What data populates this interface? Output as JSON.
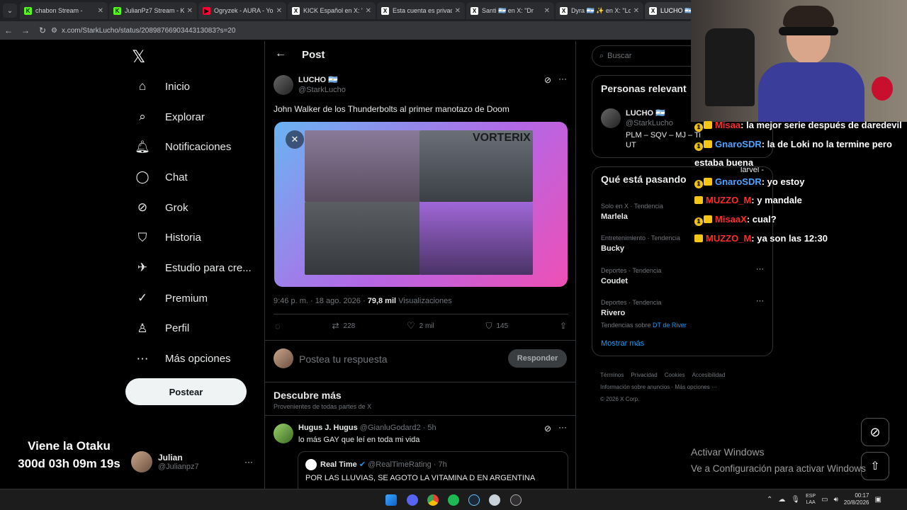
{
  "tabs": [
    {
      "label": "chabon Stream - ",
      "color": "#53fc18",
      "glyph": "K"
    },
    {
      "label": "JulianPz7 Stream - Ki",
      "color": "#53fc18",
      "glyph": "K"
    },
    {
      "label": "Ogryzek - AURA - You",
      "color": "#ff0033",
      "glyph": "▶"
    },
    {
      "label": "KICK Español en X: \"",
      "color": "#ffffff",
      "glyph": "X"
    },
    {
      "label": "Esta cuenta es privad",
      "color": "#ffffff",
      "glyph": "X"
    },
    {
      "label": "Santi 🇦🇷 en X: \"Dr",
      "color": "#ffffff",
      "glyph": "X"
    },
    {
      "label": "Dyra 🇦🇷 ✨ en X: \"Lo",
      "color": "#ffffff",
      "glyph": "X"
    },
    {
      "label": "LUCHO 🇦🇷 en X: \"",
      "color": "#ffffff",
      "glyph": "X"
    }
  ],
  "address": "x.com/StarkLucho/status/2089876690344313083?s=20",
  "nav": {
    "logo": "𝕏",
    "items": [
      {
        "icon": "home-icon",
        "glyph": "⌂",
        "label": "Inicio"
      },
      {
        "icon": "search-icon",
        "glyph": "⌕",
        "label": "Explorar"
      },
      {
        "icon": "bell-icon",
        "glyph": "🔔︎",
        "label": "Notificaciones"
      },
      {
        "icon": "chat-icon",
        "glyph": "◯",
        "label": "Chat"
      },
      {
        "icon": "grok-icon",
        "glyph": "⊘",
        "label": "Grok"
      },
      {
        "icon": "bookmark-icon",
        "glyph": "⛉",
        "label": "Historia"
      },
      {
        "icon": "rocket-icon",
        "glyph": "✈",
        "label": "Estudio para cre..."
      },
      {
        "icon": "verified-icon",
        "glyph": "✓",
        "label": "Premium"
      },
      {
        "icon": "person-icon",
        "glyph": "♙",
        "label": "Perfil"
      },
      {
        "icon": "more-icon",
        "glyph": "⋯",
        "label": "Más opciones"
      }
    ],
    "post_button": "Postear",
    "user": {
      "name": "Julian",
      "handle": "@Julianpz7",
      "more": "···"
    }
  },
  "overlay_timer": {
    "title": "Viene la Otaku",
    "countdown": "300d 03h 09m 19s"
  },
  "post": {
    "header": "Post",
    "author": "LUCHO 🇦🇷",
    "handle": "@StarkLucho",
    "text": "John Walker de los Thunderbolts al primer manotazo de Doom",
    "time": "9:46 p. m. · 18 ago. 2026 · ",
    "views": "79,8 mil",
    "views_label": " Visualizaciones",
    "media_brand": "VORTERIX",
    "retweets": "228",
    "likes": "2 mil",
    "bookmarks": "145",
    "reply_placeholder": "Postea tu respuesta",
    "reply_button": "Responder"
  },
  "discover": {
    "title": "Descubre más",
    "subtitle": "Provenientes de todas partes de X",
    "tweet": {
      "author": "Hugus J. Hugus",
      "handle": "@GianluGodard2 · 5h",
      "text": "lo más GAY que leí en toda mi vida"
    },
    "quote": {
      "author": "Real Time",
      "handle": "@RealTimeRating · 7h",
      "text": "POR LAS LLUVIAS, SE AGOTO LA VITAMINA D EN ARGENTINA"
    }
  },
  "right": {
    "search_placeholder": "Buscar",
    "relevant_title": "Personas relevant",
    "person": {
      "name": "LUCHO 🇦🇷",
      "handle": "@StarkLucho",
      "bio": "PLM – SQV – MJ – Ti",
      "bio2": "UT",
      "bio_tail": "larvel -"
    },
    "happening_title": "Qué está pasando",
    "trends": [
      {
        "meta": "Solo en X · Tendencia",
        "name": "Marlela",
        "extra": ""
      },
      {
        "meta": "Entretenimiento · Tendencia",
        "name": "Bucky",
        "extra": ""
      },
      {
        "meta": "Deportes · Tendencia",
        "name": "Coudet",
        "extra": ""
      },
      {
        "meta": "Deportes · Tendencia",
        "name": "Rivero",
        "extra": "Tendencias sobre ",
        "extra_link": "DT de River"
      }
    ],
    "show_more": "Mostrar más",
    "footer1": [
      "Términos",
      "Privacidad",
      "Cookies",
      "Accesibilidad"
    ],
    "footer2": "Información sobre anuncios · Más opciones ···",
    "footer3": "© 2026 X Corp."
  },
  "chat": [
    {
      "user": "Misaa",
      "color": "#ff2b2b",
      "msg": ": la mejor serie después de daredevil",
      "badges": [
        "1",
        "crown"
      ]
    },
    {
      "user": "GnaroSDR",
      "color": "#4da3ff",
      "msg": ": la de Loki no la termine pero estaba buena",
      "badges": [
        "1",
        "crown"
      ]
    },
    {
      "user": "GnaroSDR",
      "color": "#4da3ff",
      "msg": ": yo estoy",
      "badges": [
        "1",
        "crown"
      ]
    },
    {
      "user": "MUZZO_M",
      "color": "#ff2b2b",
      "msg": ": y mandale",
      "badges": [
        "crown"
      ]
    },
    {
      "user": "MisaaX",
      "color": "#ff2b2b",
      "msg": ": cual?",
      "badges": [
        "1",
        "crown"
      ]
    },
    {
      "user": "MUZZO_M",
      "color": "#ff2b2b",
      "msg": ": ya son las 12:30",
      "badges": [
        "crown"
      ]
    }
  ],
  "windows": {
    "line1": "Activar Windows",
    "line2": "Ve a Configuración para activar Windows"
  },
  "taskbar": {
    "lang1": "ESP",
    "lang2": "LAA",
    "time": "00:17",
    "date": "20/8/2026"
  }
}
